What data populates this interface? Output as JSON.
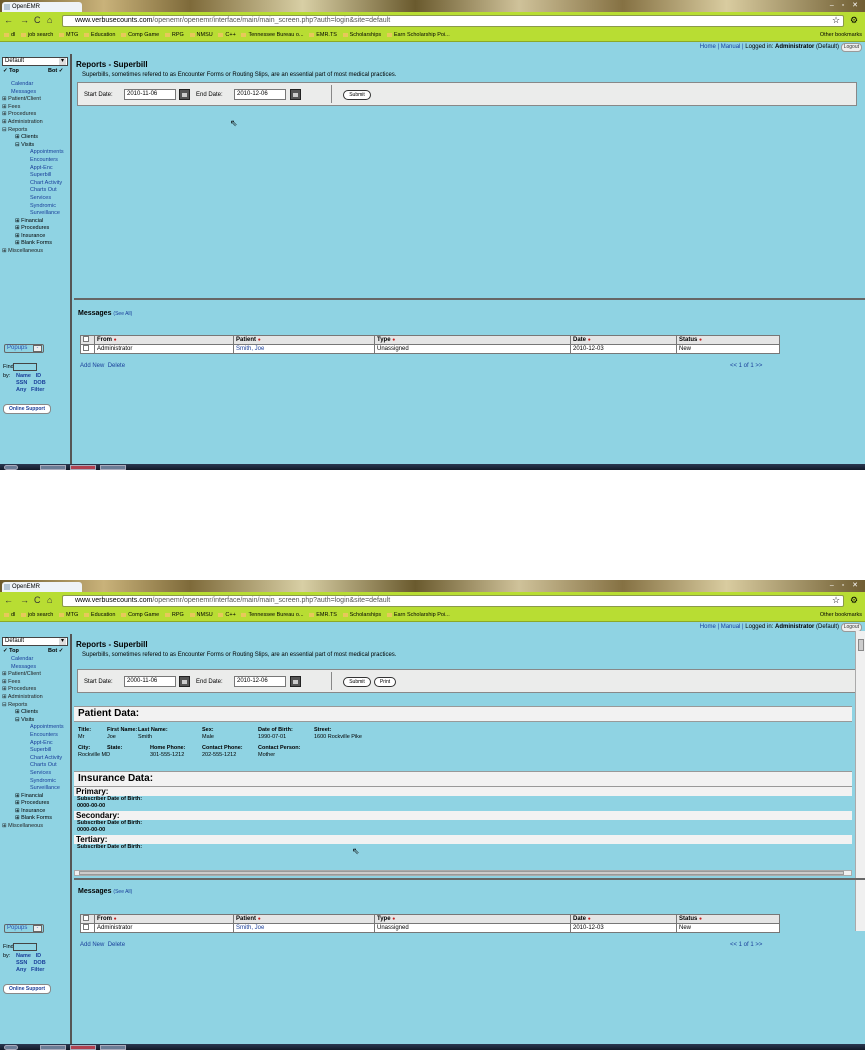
{
  "browser": {
    "tab_title": "OpenEMR",
    "url_host": "www.verbusecounts.com",
    "url_path": "/openemr/openemr/interface/main/main_screen.php?auth=login&site=default",
    "bookmarks": [
      "dl",
      "job search",
      "MTG",
      "Education",
      "Comp Game",
      "RPG",
      "NMSU",
      "C++",
      "Tennessee Bureau o...",
      "EMR.TS",
      "Scholarships",
      "Earn Scholarship Poi..."
    ],
    "other_bookmarks": "Other bookmarks"
  },
  "header": {
    "home": "Home",
    "manual": "Manual",
    "logged_in": "Logged in:",
    "user": "Administrator",
    "user_suffix": "(Default)",
    "logout": "Logout"
  },
  "sidebar": {
    "select_value": "Default",
    "top": "Top",
    "bot": "Bot",
    "items": [
      "Calendar",
      "Messages",
      "Patient/Client",
      "Fees",
      "Procedures",
      "Administration",
      "Reports",
      "Clients",
      "Visits",
      "Appointments",
      "Encounters",
      "Appt-Enc",
      "Superbill",
      "Chart Activity",
      "Charts Out",
      "Services",
      "Syndromic",
      "Surveillance",
      "Financial",
      "Procedures",
      "Insurance",
      "Blank Forms",
      "Miscellaneous"
    ],
    "popups": "Popups",
    "find_label": "Find",
    "by_label": "by:",
    "find_links": [
      "Name",
      "ID",
      "SSN",
      "DOB",
      "Any",
      "Filter"
    ],
    "online_support": "Online Support"
  },
  "report": {
    "title": "Reports - Superbill",
    "description": "Superbills, sometimes refered to as Encounter Forms or Routing Slips, are an essential part of most medical practices.",
    "start_label": "Start Date:",
    "end_label": "End Date:",
    "start_date_1": "2010-11-06",
    "start_date_2": "2000-11-06",
    "end_date": "2010-12-06",
    "submit": "Submit",
    "print": "Print"
  },
  "patient": {
    "heading": "Patient Data:",
    "title_k": "Title:",
    "title_v": "Mr",
    "first_k": "First Name:",
    "first_v": "Joe",
    "last_k": "Last Name:",
    "last_v": "Smith",
    "sex_k": "Sex:",
    "sex_v": "Male",
    "dob_k": "Date of Birth:",
    "dob_v": "1990-07-01",
    "street_k": "Street:",
    "street_v": "1600 Rockville Pike",
    "city_k": "City:",
    "city_v": "Rockville MD",
    "state_k": "State:",
    "home_k": "Home Phone:",
    "home_v": "301-555-1212",
    "contact_k": "Contact Phone:",
    "contact_v": "202-555-1212",
    "person_k": "Contact Person:",
    "person_v": "Mother"
  },
  "insurance": {
    "heading": "Insurance Data:",
    "primary": "Primary:",
    "secondary": "Secondary:",
    "tertiary": "Tertiary:",
    "sub_dob": "Subscriber Date of Birth:",
    "sub_dob_v": "0000-00-00"
  },
  "messages": {
    "heading": "Messages",
    "see_all": "(See All)",
    "columns": [
      "From",
      "Patient",
      "Type",
      "Date",
      "Status"
    ],
    "row": {
      "from": "Administrator",
      "patient": "Smith, Joe",
      "type": "Unassigned",
      "date": "2010-12-03",
      "status": "New"
    },
    "add_new": "Add New",
    "delete": "Delete",
    "pager": "<<  1 of 1  >>"
  }
}
